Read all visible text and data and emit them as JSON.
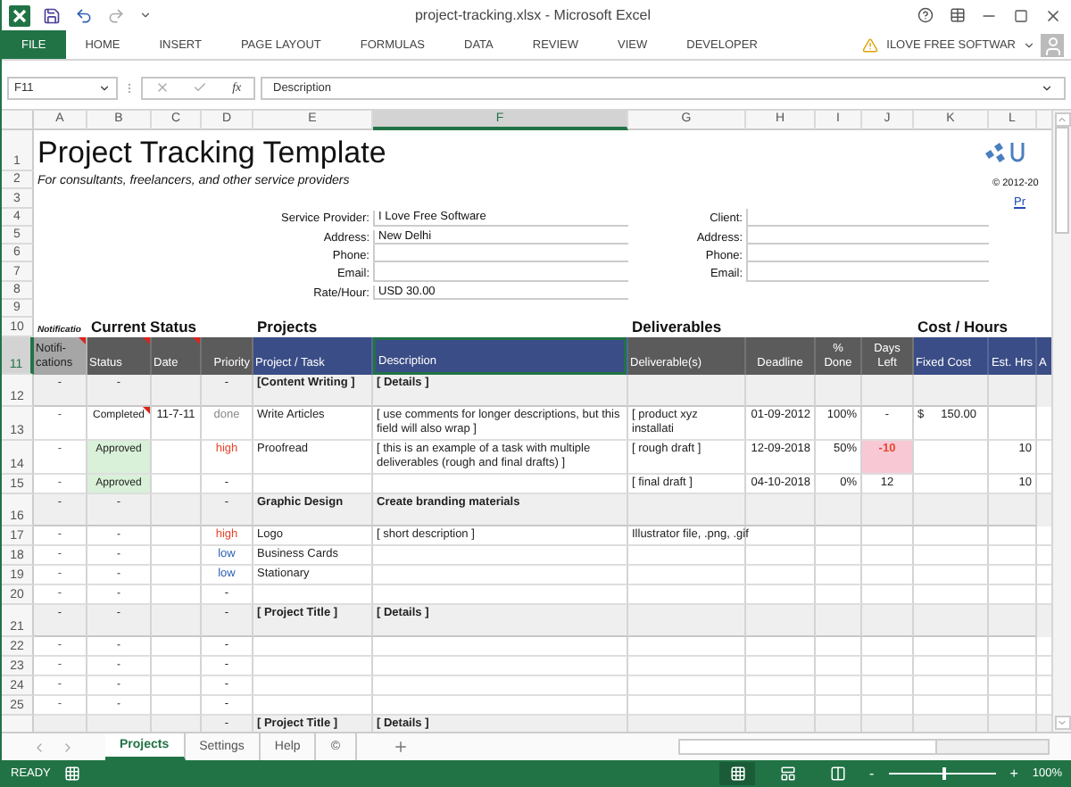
{
  "window": {
    "title": "project-tracking.xlsx - Microsoft Excel"
  },
  "ribbon_tabs": [
    {
      "label": "FILE",
      "kind": "file"
    },
    {
      "label": "HOME",
      "kind": "tab"
    },
    {
      "label": "INSERT",
      "kind": "tab"
    },
    {
      "label": "PAGE LAYOUT",
      "kind": "tab"
    },
    {
      "label": "FORMULAS",
      "kind": "tab"
    },
    {
      "label": "DATA",
      "kind": "tab"
    },
    {
      "label": "REVIEW",
      "kind": "tab"
    },
    {
      "label": "VIEW",
      "kind": "tab"
    },
    {
      "label": "DEVELOPER",
      "kind": "tab"
    }
  ],
  "account": {
    "name": "ILOVE FREE SOFTWAR"
  },
  "formula_bar": {
    "name_box": "F11",
    "function_label": "fx",
    "value": "Description"
  },
  "column_letters": [
    {
      "label": "A",
      "selected": false
    },
    {
      "label": "B",
      "selected": false
    },
    {
      "label": "C",
      "selected": false
    },
    {
      "label": "D",
      "selected": false
    },
    {
      "label": "E",
      "selected": false
    },
    {
      "label": "F",
      "selected": true
    },
    {
      "label": "G",
      "selected": false
    },
    {
      "label": "H",
      "selected": false
    },
    {
      "label": "I",
      "selected": false
    },
    {
      "label": "J",
      "selected": false
    },
    {
      "label": "K",
      "selected": false
    },
    {
      "label": "L",
      "selected": false
    }
  ],
  "top_row_numbers": [
    "1",
    "2",
    "3",
    "4",
    "5",
    "6",
    "7",
    "8",
    "9",
    "10"
  ],
  "header": {
    "title": "Project Tracking Template",
    "subtitle": "For consultants, freelancers, and other service providers",
    "copyright": "© 2012-20",
    "link": "Pr"
  },
  "provider_fields": [
    {
      "label": "Service Provider:",
      "value": "I Love Free Software"
    },
    {
      "label": "Address:",
      "value": "New Delhi"
    },
    {
      "label": "Phone:"
    },
    {
      "label": "Email:"
    },
    {
      "label": "Rate/Hour:",
      "value": "USD 30.00"
    }
  ],
  "client_fields": [
    {
      "label": "Client:"
    },
    {
      "label": "Address:"
    },
    {
      "label": "Phone:"
    },
    {
      "label": "Email:"
    }
  ],
  "section_titles": {
    "notifications": "Notificatio",
    "status": "Current Status",
    "projects": "Projects",
    "deliverables": "Deliverables",
    "cost": "Cost / Hours"
  },
  "header_row": {
    "number": "11",
    "selected": true,
    "columns": [
      {
        "label": "Notifi-cations",
        "kind": "muted",
        "comment": true,
        "selected": false
      },
      {
        "label": "Status",
        "kind": "dark",
        "comment": true,
        "selected": false
      },
      {
        "label": "Date",
        "kind": "dark",
        "comment": true,
        "selected": false
      },
      {
        "label": "Priority",
        "kind": "dark",
        "comment": false,
        "selected": false
      },
      {
        "label": "Project / Task",
        "kind": "blue",
        "comment": false,
        "selected": false
      },
      {
        "label": "Description",
        "kind": "blue",
        "comment": false,
        "selected": true
      },
      {
        "label": "Deliverable(s)",
        "kind": "dark",
        "comment": false,
        "selected": false
      },
      {
        "label": "Deadline",
        "kind": "dark",
        "comment": false,
        "selected": false
      },
      {
        "label": "% Done",
        "kind": "dark",
        "comment": false,
        "selected": false
      },
      {
        "label": "Days Left",
        "kind": "dark",
        "comment": false,
        "selected": false
      },
      {
        "label": "Fixed Cost",
        "kind": "blue",
        "comment": false,
        "selected": false
      },
      {
        "label": "Est. Hrs",
        "kind": "blue",
        "comment": false,
        "selected": false
      },
      {
        "label": "A",
        "kind": "blue",
        "comment": false,
        "selected": false
      }
    ]
  },
  "rows": [
    {
      "kind": "group",
      "number": "12",
      "notification": "-",
      "status": "-",
      "priority": "-",
      "task": "[Content Writing ]",
      "description": "[ Details ]"
    },
    {
      "kind": "task",
      "number": "13",
      "notification": "-",
      "status": {
        "text": "Completed",
        "kind": "completed",
        "comment": true
      },
      "date": "11-7-11",
      "priority": {
        "text": "done",
        "kind": "done"
      },
      "task": "Write Articles",
      "description": "[ use comments for longer descriptions, but this field will also wrap ]",
      "deliverable": "[ product xyz installati",
      "deadline": "01-09-2012",
      "done": "100%",
      "days_left": "-",
      "overdue": false,
      "currency": "$",
      "fixed_cost": "150.00"
    },
    {
      "kind": "task",
      "number": "14",
      "notification": "-",
      "status": {
        "text": "Approved",
        "kind": "approved",
        "comment": false
      },
      "priority": {
        "text": "high",
        "kind": "high"
      },
      "task": "Proofread",
      "description": "[ this is an example of a task with multiple deliverables (rough and final drafts) ]",
      "deliverable": "[ rough draft ]",
      "deadline": "12-09-2018",
      "done": "50%",
      "days_left": "-10",
      "overdue": true,
      "est_hrs": "10"
    },
    {
      "kind": "task",
      "number": "15",
      "notification": "-",
      "status": {
        "text": "Approved",
        "kind": "approved",
        "comment": false
      },
      "priority": {
        "text": "-",
        "kind": "none"
      },
      "deliverable": "[ final draft ]",
      "deadline": "04-10-2018",
      "done": "0%",
      "days_left": "12",
      "overdue": false,
      "est_hrs": "10"
    },
    {
      "kind": "group",
      "number": "16",
      "notification": "-",
      "status": "-",
      "priority": "-",
      "task": "Graphic Design",
      "description": "Create branding materials"
    },
    {
      "kind": "task",
      "number": "17",
      "notification": "-",
      "status": {
        "text": "-",
        "kind": "none",
        "comment": false
      },
      "priority": {
        "text": "high",
        "kind": "high"
      },
      "task": "Logo",
      "description": "[ short description ]",
      "deliverable": "Illustrator file, .png, .gif",
      "overdue": false
    },
    {
      "kind": "task",
      "number": "18",
      "notification": "-",
      "status": {
        "text": "-",
        "kind": "none",
        "comment": false
      },
      "priority": {
        "text": "low",
        "kind": "low"
      },
      "task": "Business Cards",
      "overdue": false
    },
    {
      "kind": "task",
      "number": "19",
      "notification": "-",
      "status": {
        "text": "-",
        "kind": "none",
        "comment": false
      },
      "priority": {
        "text": "low",
        "kind": "low"
      },
      "task": "Stationary",
      "overdue": false
    },
    {
      "kind": "task",
      "number": "20",
      "notification": "-",
      "status": {
        "text": "-",
        "kind": "none",
        "comment": false
      },
      "priority": {
        "text": "-",
        "kind": "none"
      },
      "overdue": false
    },
    {
      "kind": "group",
      "number": "21",
      "notification": "-",
      "status": "-",
      "priority": "-",
      "task": "[ Project Title ]",
      "description": "[ Details ]"
    },
    {
      "kind": "task",
      "number": "22",
      "notification": "-",
      "status": {
        "text": "-",
        "kind": "none",
        "comment": false
      },
      "priority": {
        "text": "-",
        "kind": "none"
      },
      "overdue": false
    },
    {
      "kind": "task",
      "number": "23",
      "notification": "-",
      "status": {
        "text": "-",
        "kind": "none",
        "comment": false
      },
      "priority": {
        "text": "-",
        "kind": "none"
      },
      "overdue": false
    },
    {
      "kind": "task",
      "number": "24",
      "notification": "-",
      "status": {
        "text": "-",
        "kind": "none",
        "comment": false
      },
      "priority": {
        "text": "-",
        "kind": "none"
      },
      "overdue": false
    },
    {
      "kind": "task",
      "number": "25",
      "notification": "-",
      "status": {
        "text": "-",
        "kind": "none",
        "comment": false
      },
      "priority": {
        "text": "-",
        "kind": "none"
      },
      "overdue": false
    },
    {
      "kind": "group",
      "priority": "-",
      "task": "[ Project Title ]",
      "description": "[ Details ]"
    }
  ],
  "sheet_tabs": [
    {
      "label": "Projects",
      "selected": true
    },
    {
      "label": "Settings",
      "selected": false
    },
    {
      "label": "Help",
      "selected": false
    },
    {
      "label": "©",
      "selected": false
    }
  ],
  "status_bar": {
    "mode": "READY",
    "zoom_minus": "-",
    "zoom_plus": "+",
    "zoom": "100%",
    "zoom_level": {
      "level": 0.5
    }
  }
}
